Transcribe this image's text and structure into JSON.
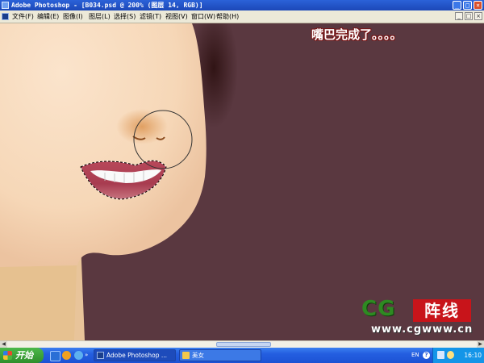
{
  "window": {
    "title": "Adobe Photoshop - [B034.psd @ 200% (图层 14, RGB)]",
    "controls": {
      "minimize": "_",
      "maximize": "□",
      "close": "×"
    }
  },
  "menu": {
    "items": [
      "文件(F)",
      "编辑(E)",
      "图像(I)",
      "图层(L)",
      "选择(S)",
      "滤镜(T)",
      "视图(V)",
      "窗口(W)",
      "帮助(H)"
    ],
    "doc_controls": {
      "minimize": "_",
      "restore": "□",
      "close": "×"
    }
  },
  "canvas": {
    "caption": "嘴巴完成了。。。。",
    "background_color": "#5a3840",
    "skin_color": "#f5d6b8",
    "lip_color": "#a83c50"
  },
  "watermark": {
    "logo": "CG",
    "tag": "阵线",
    "url": "www.cgwww.cn"
  },
  "scrollbar": {
    "left_arrow": "◀",
    "right_arrow": "▶"
  },
  "taskbar": {
    "start_label": "开始",
    "tasks": [
      {
        "label": "Adobe Photoshop ..."
      },
      {
        "label": "美女"
      }
    ],
    "language": "EN",
    "help_icon": "?",
    "clock": "16:10"
  }
}
